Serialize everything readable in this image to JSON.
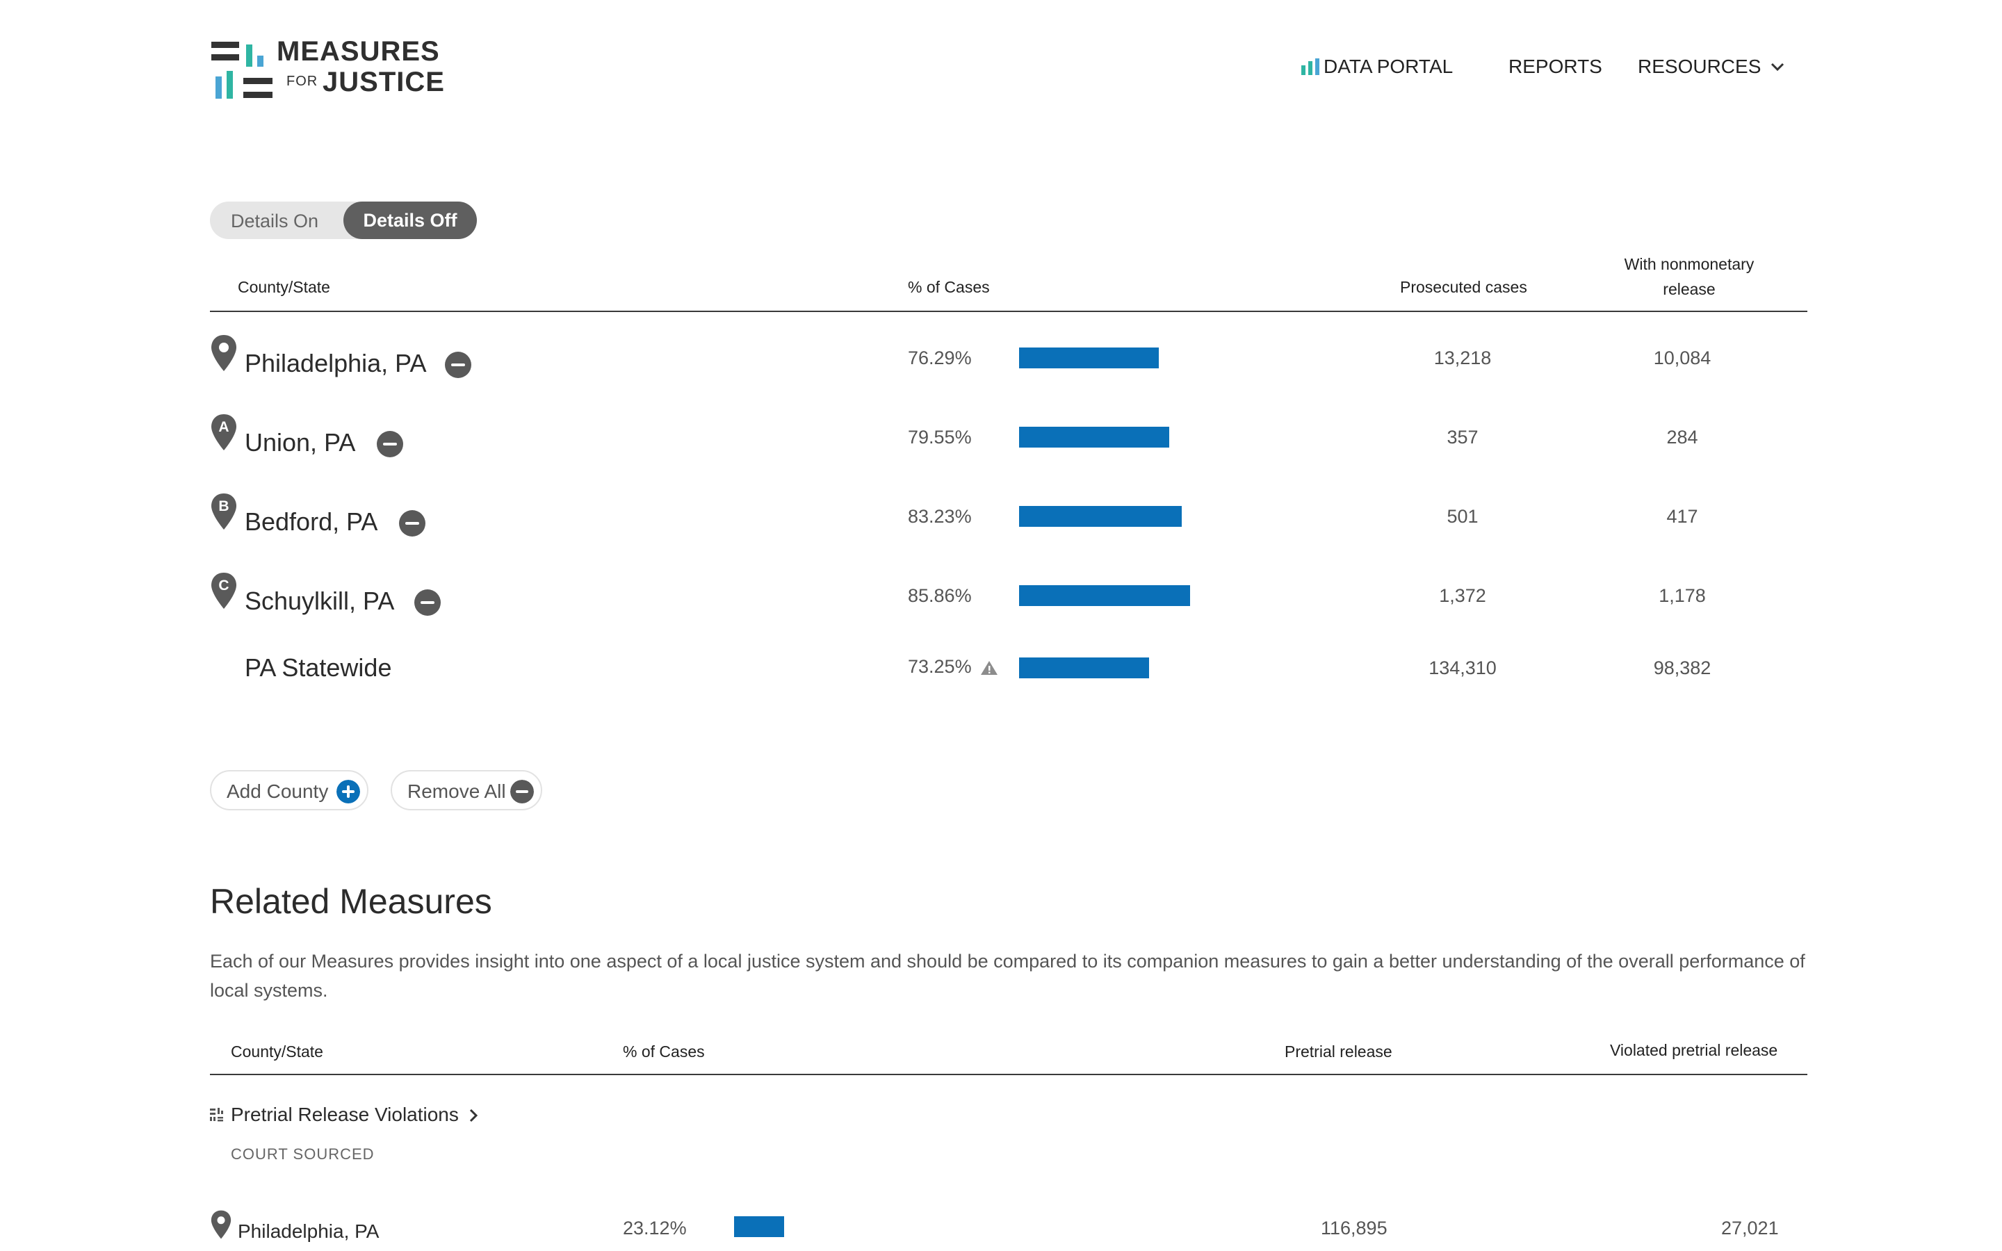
{
  "brand": {
    "line1": "MEASURES",
    "for": "FOR",
    "line2": "JUSTICE",
    "colors": {
      "dark": "#333333",
      "teal": "#2fb5a3",
      "blue": "#4aa5d4",
      "bar_blue": "#0a70b8"
    }
  },
  "nav": {
    "data_portal": "DATA PORTAL",
    "reports": "REPORTS",
    "resources": "RESOURCES"
  },
  "toggle": {
    "on_label": "Details On",
    "off_label": "Details Off",
    "active": "Details Off"
  },
  "main_table": {
    "headers": {
      "county": "County/State",
      "pct": "% of Cases",
      "prosecuted": "Prosecuted cases",
      "nonmonetary_1": "With nonmonetary",
      "nonmonetary_2": "release"
    },
    "rows": [
      {
        "county": "Philadelphia, PA",
        "marker": "",
        "pct": "76.29%",
        "pct_value": 76.29,
        "prosecuted": "13,218",
        "nonmonetary": "10,084"
      },
      {
        "county": "Union, PA",
        "marker": "A",
        "pct": "79.55%",
        "pct_value": 79.55,
        "prosecuted": "357",
        "nonmonetary": "284"
      },
      {
        "county": "Bedford, PA",
        "marker": "B",
        "pct": "83.23%",
        "pct_value": 83.23,
        "prosecuted": "501",
        "nonmonetary": "417"
      },
      {
        "county": "Schuylkill, PA",
        "marker": "C",
        "pct": "85.86%",
        "pct_value": 85.86,
        "prosecuted": "1,372",
        "nonmonetary": "1,178"
      },
      {
        "county": "PA Statewide",
        "pct": "73.25%",
        "pct_value": 73.25,
        "prosecuted": "134,310",
        "nonmonetary": "98,382"
      }
    ]
  },
  "actions": {
    "add_county": "Add County",
    "remove_all": "Remove All"
  },
  "related": {
    "title": "Related Measures",
    "description": "Each of our Measures provides insight into one aspect of a local justice system and should be compared to its companion measures to gain a better understanding of the overall performance of local systems.",
    "headers": {
      "county": "County/State",
      "pct": "% of Cases",
      "pretrial": "Pretrial release",
      "violated": "Violated pretrial release"
    },
    "measure": {
      "title": "Pretrial Release Violations",
      "source": "COURT SOURCED"
    },
    "rows": [
      {
        "county": "Philadelphia, PA",
        "pct": "23.12%",
        "pct_value": 23.12,
        "pretrial": "116,895",
        "violated": "27,021"
      }
    ]
  }
}
